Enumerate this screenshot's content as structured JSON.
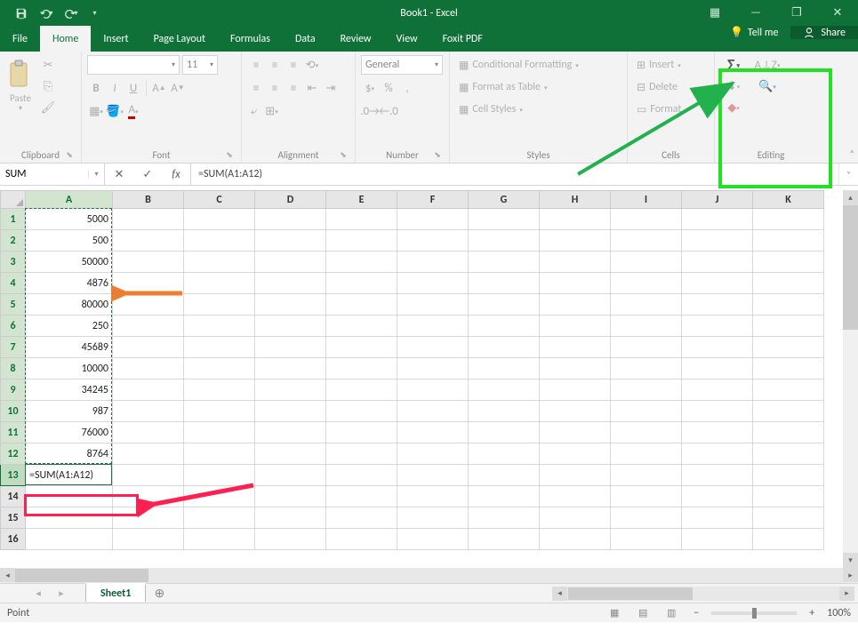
{
  "title": "Book1 - Excel",
  "qat": {
    "save_tip": "Save",
    "undo_tip": "Undo",
    "redo_tip": "Redo"
  },
  "window": {
    "ribbon_opts": "▦",
    "min": "—",
    "restore": "❐",
    "close": "✕"
  },
  "tabs": {
    "file": "File",
    "home": "Home",
    "insert": "Insert",
    "page_layout": "Page Layout",
    "formulas": "Formulas",
    "data": "Data",
    "review": "Review",
    "view": "View",
    "foxit": "Foxit PDF",
    "tellme": "Tell me",
    "share": "Share"
  },
  "ribbon": {
    "clipboard": {
      "label": "Clipboard",
      "paste": "Paste"
    },
    "font": {
      "label": "Font",
      "family": "",
      "size": "11",
      "bold": "B",
      "italic": "I",
      "underline": "U"
    },
    "alignment": {
      "label": "Alignment"
    },
    "number": {
      "label": "Number",
      "format": "General"
    },
    "styles": {
      "label": "Styles",
      "cond": "Conditional Formatting",
      "table": "Format as Table",
      "cell": "Cell Styles"
    },
    "cells": {
      "label": "Cells",
      "insert": "Insert",
      "delete": "Delete",
      "format": "Format"
    },
    "editing": {
      "label": "Editing"
    }
  },
  "formula_bar": {
    "name_box": "SUM",
    "formula": "=SUM(A1:A12)"
  },
  "columns": [
    "A",
    "B",
    "C",
    "D",
    "E",
    "F",
    "G",
    "H",
    "I",
    "J",
    "K"
  ],
  "rows_count": 16,
  "col_a_values": [
    "5000",
    "500",
    "50000",
    "4876",
    "80000",
    "250",
    "45689",
    "10000",
    "34245",
    "987",
    "76000",
    "8764",
    "=SUM(A1:A12)",
    "",
    "",
    ""
  ],
  "active_cell_row": 13,
  "selection_range": "A1:A12",
  "sheets": {
    "active": "Sheet1"
  },
  "status": {
    "mode": "Point",
    "zoom": "100%"
  },
  "colors": {
    "theme": "#0f7138",
    "highlight_green": "#22e122",
    "highlight_pink": "#ff2052",
    "arrow_orange": "#ed7d31",
    "arrow_green": "#22b14c"
  }
}
